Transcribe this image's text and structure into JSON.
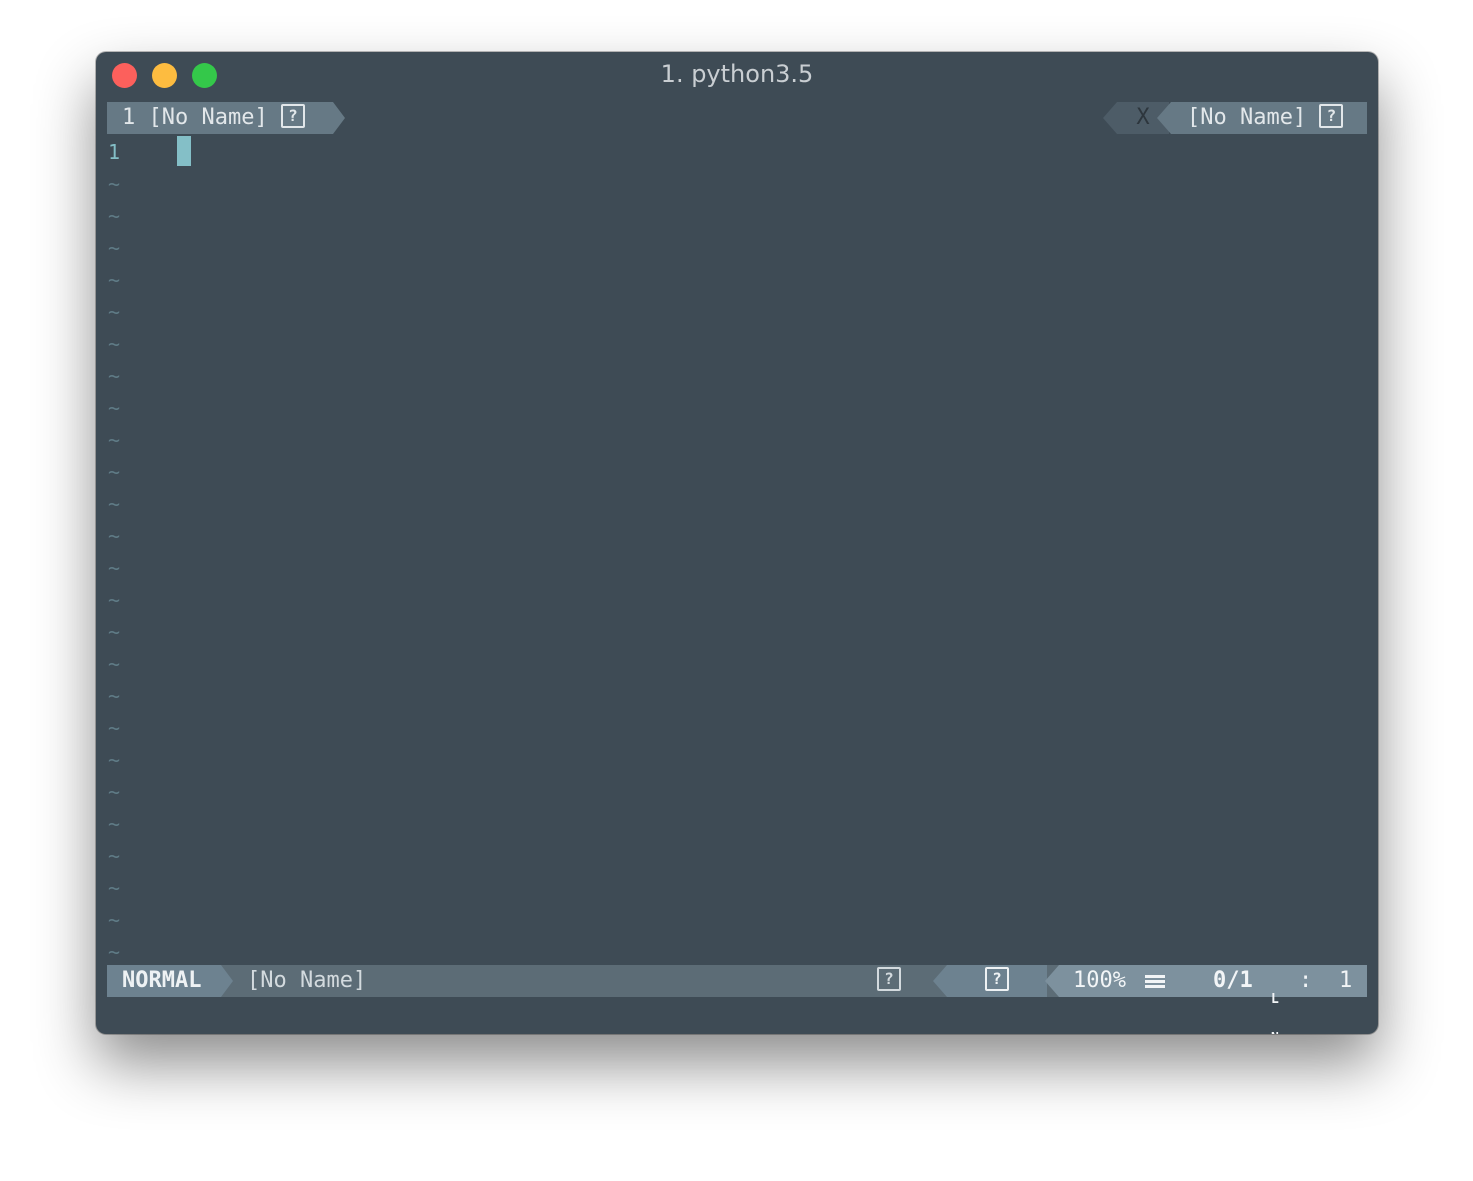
{
  "window": {
    "title": "1. python3.5"
  },
  "tabline": {
    "active_tab": "1 [No Name]",
    "close_label": "X",
    "right_label": "[No Name]",
    "unknown_glyph": "?"
  },
  "editor": {
    "line_number": "1",
    "empty_line_marker": "~",
    "empty_line_count": 25
  },
  "statusline": {
    "mode": "NORMAL",
    "filename": "[No Name]",
    "unknown_glyph": "?",
    "percent": "100%",
    "position": "0/1",
    "ln_icon_top": "L",
    "ln_icon_bottom": "N",
    "col_separator": ":",
    "column": "1"
  },
  "colors": {
    "background": "#3e4b55",
    "accent": "#84bfc7",
    "tab_active": "#667985",
    "status_mode": "#6d8290",
    "status_right": "#7d919e"
  },
  "icons": {
    "close": "close-circle-icon",
    "minimize": "minimize-circle-icon",
    "maximize": "maximize-circle-icon",
    "menu": "hamburger-icon",
    "unknown": "question-box-icon",
    "line_number": "ln-icon"
  }
}
